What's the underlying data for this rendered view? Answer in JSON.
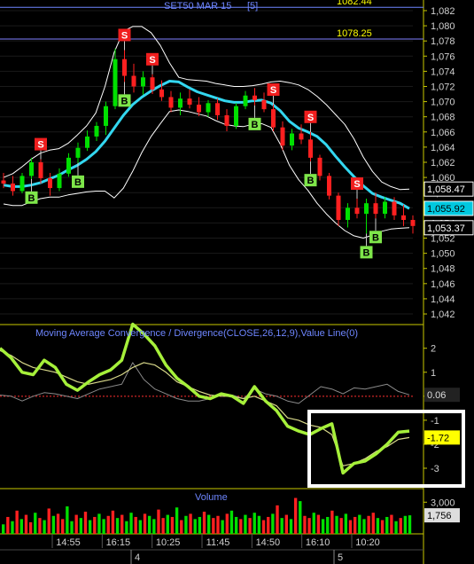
{
  "chart_data": [
    {
      "type": "candlestick",
      "title": "SET50 MAR 15",
      "title_suffix": "[5]",
      "y_ticks": [
        "1,082",
        "1,080",
        "1,078",
        "1,076",
        "1,074",
        "1,072",
        "1,070",
        "1,068",
        "1,066",
        "1,064",
        "1,062",
        "1,060",
        "1,058",
        "1,056",
        "1,054",
        "1,052",
        "1,050",
        "1,048",
        "1,046",
        "1,044",
        "1,042"
      ],
      "ylim": [
        1040.6,
        1083.4
      ],
      "reference_lines": [
        {
          "label": "1082.44",
          "value": 1082.44
        },
        {
          "label": "1078.25",
          "value": 1078.25
        }
      ],
      "price_badges": [
        {
          "label": "1,058.47",
          "value": 1058.47,
          "color": "#ffffff"
        },
        {
          "label": "1,055.92",
          "value": 1055.92,
          "color": "#00c8e0"
        },
        {
          "label": "1,053.37",
          "value": 1053.37,
          "color": "#ffffff"
        }
      ],
      "bollinger_middle": [
        1059,
        1058.8,
        1058.8,
        1059,
        1059.3,
        1059.8,
        1060.3,
        1061,
        1061.6,
        1062.4,
        1063.4,
        1064.8,
        1066.5,
        1068.2,
        1069.6,
        1070.6,
        1071.4,
        1072.1,
        1072.7,
        1072.6,
        1071.9,
        1071.3,
        1070.9,
        1070.5,
        1070.1,
        1069.9,
        1069.9,
        1070.1,
        1070.2,
        1069.8,
        1068.8,
        1067.4,
        1066.5,
        1066,
        1065.4,
        1064.3,
        1062.8,
        1061.4,
        1060.1,
        1058.9,
        1057.9,
        1057.4,
        1057,
        1056.6,
        1055.9
      ],
      "bollinger_upper": [
        1060,
        1060.5,
        1061.4,
        1062.4,
        1063.2,
        1063.6,
        1063.8,
        1064.5,
        1065.6,
        1066.8,
        1068.5,
        1072,
        1076.5,
        1079.3,
        1079.9,
        1079.9,
        1079.1,
        1077.4,
        1075.1,
        1073.2,
        1072.9,
        1072.8,
        1072.7,
        1072.4,
        1072.2,
        1072,
        1072,
        1072.1,
        1072.3,
        1072.6,
        1072.7,
        1072.5,
        1072.2,
        1071.6,
        1070.7,
        1069.6,
        1068.3,
        1067,
        1065.1,
        1062.7,
        1060.8,
        1059.4,
        1058.8,
        1058.4,
        1058.47
      ],
      "bollinger_lower": [
        1056.5,
        1056.3,
        1056.3,
        1056.8,
        1057.2,
        1057.4,
        1057.4,
        1057.7,
        1057.9,
        1058.1,
        1058.2,
        1058.2,
        1057.3,
        1058.6,
        1060.8,
        1063.3,
        1065.4,
        1067.1,
        1068.7,
        1068.9,
        1068.7,
        1068.4,
        1068.1,
        1067.5,
        1067,
        1066.8,
        1066.7,
        1067,
        1067.1,
        1066.6,
        1064.4,
        1061.6,
        1059.7,
        1058.3,
        1056.6,
        1055.2,
        1054,
        1053,
        1052.3,
        1052,
        1052.4,
        1052.9,
        1053.2,
        1053.3,
        1053.37
      ],
      "candles": [
        {
          "o": 1059.6,
          "h": 1060.6,
          "l": 1058.6,
          "c": 1059.2
        },
        {
          "o": 1059.2,
          "h": 1060.2,
          "l": 1057.6,
          "c": 1058.2
        },
        {
          "o": 1058.2,
          "h": 1060.6,
          "l": 1057.9,
          "c": 1060.2
        },
        {
          "o": 1060.2,
          "h": 1062.6,
          "l": 1059.8,
          "c": 1062.0
        },
        {
          "o": 1062.0,
          "h": 1062.4,
          "l": 1059.2,
          "c": 1059.9
        },
        {
          "o": 1059.9,
          "h": 1060.6,
          "l": 1057.6,
          "c": 1058.6
        },
        {
          "o": 1058.6,
          "h": 1061.2,
          "l": 1058.2,
          "c": 1060.5
        },
        {
          "o": 1060.5,
          "h": 1063.2,
          "l": 1060.1,
          "c": 1062.6
        },
        {
          "o": 1062.6,
          "h": 1064.6,
          "l": 1061.9,
          "c": 1063.9
        },
        {
          "o": 1063.9,
          "h": 1066.2,
          "l": 1063.5,
          "c": 1065.4
        },
        {
          "o": 1065.4,
          "h": 1067.3,
          "l": 1064.8,
          "c": 1066.8
        },
        {
          "o": 1066.8,
          "h": 1070.0,
          "l": 1065.6,
          "c": 1069.4
        },
        {
          "o": 1069.4,
          "h": 1077.0,
          "l": 1069.0,
          "c": 1075.6
        },
        {
          "o": 1075.6,
          "h": 1076.8,
          "l": 1072.6,
          "c": 1073.4
        },
        {
          "o": 1073.4,
          "h": 1075.0,
          "l": 1071.2,
          "c": 1072.0
        },
        {
          "o": 1072.0,
          "h": 1074.0,
          "l": 1070.9,
          "c": 1073.2
        },
        {
          "o": 1073.2,
          "h": 1073.6,
          "l": 1071.0,
          "c": 1071.6
        },
        {
          "o": 1071.6,
          "h": 1072.8,
          "l": 1070.1,
          "c": 1070.6
        },
        {
          "o": 1070.6,
          "h": 1071.4,
          "l": 1068.6,
          "c": 1069.2
        },
        {
          "o": 1069.2,
          "h": 1071.2,
          "l": 1068.2,
          "c": 1070.4
        },
        {
          "o": 1070.4,
          "h": 1071.6,
          "l": 1069.1,
          "c": 1069.6
        },
        {
          "o": 1069.6,
          "h": 1070.6,
          "l": 1068.1,
          "c": 1068.6
        },
        {
          "o": 1068.6,
          "h": 1070.2,
          "l": 1068.0,
          "c": 1069.8
        },
        {
          "o": 1069.8,
          "h": 1070.4,
          "l": 1067.6,
          "c": 1068.2
        },
        {
          "o": 1068.2,
          "h": 1069.0,
          "l": 1066.1,
          "c": 1066.8
        },
        {
          "o": 1066.8,
          "h": 1069.8,
          "l": 1066.4,
          "c": 1069.4
        },
        {
          "o": 1069.4,
          "h": 1071.4,
          "l": 1069.0,
          "c": 1070.8
        },
        {
          "o": 1070.8,
          "h": 1071.8,
          "l": 1069.5,
          "c": 1070.2
        },
        {
          "o": 1070.2,
          "h": 1071.2,
          "l": 1068.6,
          "c": 1069.0
        },
        {
          "o": 1069.0,
          "h": 1069.6,
          "l": 1066.1,
          "c": 1066.6
        },
        {
          "o": 1066.6,
          "h": 1067.4,
          "l": 1063.6,
          "c": 1064.2
        },
        {
          "o": 1064.2,
          "h": 1066.4,
          "l": 1063.6,
          "c": 1065.8
        },
        {
          "o": 1065.8,
          "h": 1067.0,
          "l": 1064.4,
          "c": 1065.0
        },
        {
          "o": 1065.0,
          "h": 1066.0,
          "l": 1062.1,
          "c": 1062.6
        },
        {
          "o": 1062.6,
          "h": 1063.0,
          "l": 1059.6,
          "c": 1060.2
        },
        {
          "o": 1060.2,
          "h": 1060.6,
          "l": 1057.1,
          "c": 1057.6
        },
        {
          "o": 1057.6,
          "h": 1058.0,
          "l": 1053.6,
          "c": 1054.4
        },
        {
          "o": 1054.4,
          "h": 1056.6,
          "l": 1053.4,
          "c": 1056.0
        },
        {
          "o": 1056.0,
          "h": 1057.2,
          "l": 1054.6,
          "c": 1055.2
        },
        {
          "o": 1055.2,
          "h": 1057.2,
          "l": 1052.6,
          "c": 1056.6
        },
        {
          "o": 1056.6,
          "h": 1058.0,
          "l": 1054.6,
          "c": 1055.2
        },
        {
          "o": 1055.2,
          "h": 1057.4,
          "l": 1054.6,
          "c": 1056.8
        },
        {
          "o": 1056.8,
          "h": 1057.4,
          "l": 1054.4,
          "c": 1055.0
        },
        {
          "o": 1055.0,
          "h": 1056.4,
          "l": 1053.6,
          "c": 1054.4
        },
        {
          "o": 1054.4,
          "h": 1055.0,
          "l": 1052.6,
          "c": 1053.6
        }
      ],
      "buy_signals": [
        {
          "label": "B",
          "index": 3
        },
        {
          "label": "B",
          "index": 8
        },
        {
          "label": "B",
          "index": 13
        },
        {
          "label": "B",
          "index": 27
        },
        {
          "label": "B",
          "index": 33
        },
        {
          "label": "B",
          "index": 39
        },
        {
          "label": "B",
          "index": 40
        }
      ],
      "sell_signals": [
        {
          "label": "S",
          "index": 4
        },
        {
          "label": "S",
          "index": 13
        },
        {
          "label": "S",
          "index": 16
        },
        {
          "label": "S",
          "index": 29
        },
        {
          "label": "S",
          "index": 33
        },
        {
          "label": "S",
          "index": 38
        }
      ]
    },
    {
      "type": "line",
      "title": "Moving Average Convergence / Divergence(CLOSE,26,12,9),Value Line(0)",
      "y_ticks": [
        "2",
        "1",
        "0",
        "-1",
        "-2",
        "-3"
      ],
      "ylim": [
        -3.85,
        2.95
      ],
      "zero_line": 0,
      "value_badges": [
        {
          "label": "0.06",
          "value": 0.06,
          "color": "#cccccc"
        },
        {
          "label": "-1.72",
          "value": -1.72,
          "color": "#ffff00"
        }
      ],
      "series": [
        {
          "values": [
            2.0,
            1.6,
            1.0,
            0.9,
            1.5,
            1.2,
            0.5,
            0.25,
            0.6,
            0.9,
            1.1,
            1.5,
            3.0,
            2.6,
            2.1,
            1.3,
            0.75,
            0.4,
            0.0,
            -0.1,
            0.1,
            0.0,
            -0.3,
            0.4,
            -0.2,
            -0.6,
            -1.25,
            -1.45,
            -1.6,
            -1.35,
            -1.15,
            -3.2,
            -2.8,
            -2.7,
            -2.4,
            -2.0,
            -1.5,
            -1.45
          ]
        },
        {
          "values": [
            1.9,
            1.7,
            1.4,
            1.2,
            1.1,
            1.0,
            0.8,
            0.6,
            0.5,
            0.6,
            0.7,
            0.9,
            1.2,
            1.4,
            1.3,
            1.0,
            0.6,
            0.4,
            0.2,
            0.05,
            0.0,
            0.0,
            -0.1,
            0.0,
            -0.2,
            -0.4,
            -0.9,
            -1.0,
            -1.2,
            -1.3,
            -1.6,
            -2.9,
            -2.8,
            -2.6,
            -2.3,
            -2.1,
            -1.8,
            -1.72
          ]
        },
        {
          "values": [
            0.05,
            0.0,
            -0.2,
            0.0,
            0.15,
            0.1,
            0.0,
            -0.1,
            0.1,
            0.3,
            0.4,
            0.5,
            1.4,
            0.7,
            0.3,
            0.1,
            -0.1,
            -0.2,
            -0.2,
            -0.1,
            0.1,
            0.05,
            -0.1,
            0.3,
            0.1,
            0.0,
            -0.2,
            -0.3,
            0.05,
            0.4,
            0.3,
            0.1,
            0.35,
            0.3,
            0.4,
            0.5,
            0.2,
            0.06
          ]
        }
      ]
    },
    {
      "type": "bar",
      "title": "Volume",
      "y_ticks": [
        "3,000"
      ],
      "ylim": [
        0,
        4200
      ],
      "value_badges": [
        {
          "label": "1,756",
          "value": 1756
        }
      ],
      "values": [
        900,
        1600,
        1200,
        2200,
        1400,
        1800,
        1100,
        2000,
        1500,
        1300,
        2400,
        1700,
        1900,
        1400,
        2600,
        1200,
        1800,
        1500,
        2100,
        1300,
        1600,
        1900,
        1400,
        1700,
        2200,
        1500,
        1800,
        1200,
        2000,
        1600,
        1300,
        1900,
        1700,
        1400,
        2300,
        1500,
        1800,
        1600,
        2500,
        1300,
        1700,
        1900,
        1400,
        1600,
        2100,
        1800,
        1500,
        1700,
        1300,
        1900,
        2200,
        1600,
        1400,
        1800,
        1500,
        2000,
        1700,
        1300,
        1600,
        1900,
        2700,
        1500,
        1800,
        1400,
        3400,
        3100,
        1700,
        1500,
        2000,
        1800,
        1400,
        1600,
        2200,
        1700,
        1500,
        1900,
        1300,
        1600,
        1800,
        1400,
        1700,
        2000,
        1500,
        1300,
        1600,
        1800,
        1200,
        1500,
        1700,
        1756
      ],
      "colors": [
        "green",
        "red",
        "green",
        "red",
        "green",
        "red",
        "red",
        "green",
        "red",
        "green",
        "red",
        "green",
        "red",
        "red",
        "green",
        "green",
        "red",
        "green",
        "red",
        "green",
        "red",
        "green",
        "green",
        "red",
        "red",
        "green",
        "red",
        "green",
        "green",
        "red",
        "green",
        "red",
        "green",
        "green",
        "red",
        "red",
        "green",
        "red",
        "green",
        "red",
        "green",
        "red",
        "green",
        "green",
        "red",
        "green",
        "red",
        "red",
        "green",
        "red",
        "green",
        "green",
        "red",
        "green",
        "red",
        "green",
        "green",
        "red",
        "red",
        "green",
        "red",
        "green",
        "red",
        "green",
        "red",
        "green",
        "red",
        "red",
        "green",
        "red",
        "green",
        "green",
        "red",
        "green",
        "red",
        "green",
        "red",
        "red",
        "green",
        "green",
        "red",
        "red",
        "green",
        "red",
        "green",
        "red",
        "green",
        "red",
        "green",
        "green"
      ]
    }
  ],
  "x_axis": {
    "time_labels": [
      "14:55",
      "16:15",
      "10:25",
      "11:45",
      "14:50",
      "16:10",
      "10:20"
    ],
    "date_labels": [
      "4",
      "5"
    ]
  }
}
